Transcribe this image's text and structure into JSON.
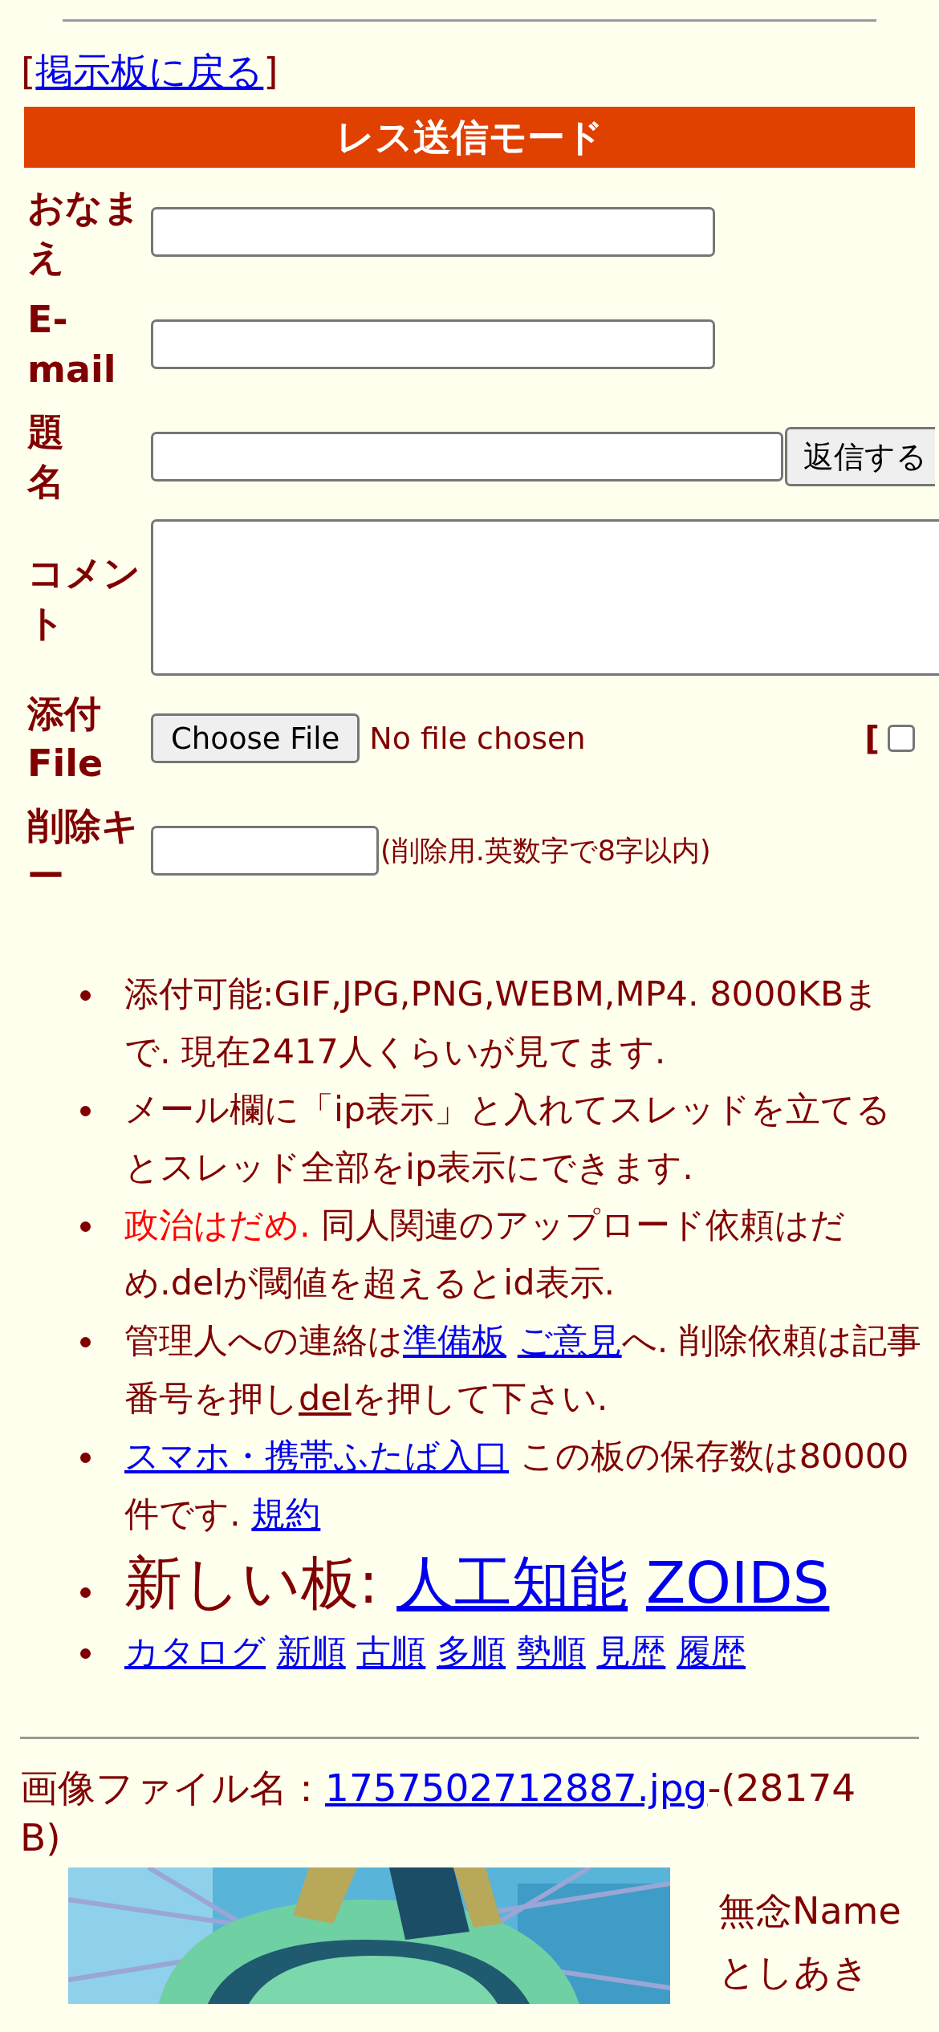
{
  "back_link": {
    "before": "[",
    "label": "掲示板に戻る",
    "after": "]"
  },
  "form_header": "レス送信モード",
  "form_rows": [
    {
      "kind": "text",
      "label": "おなまえ"
    },
    {
      "kind": "text",
      "label": "E-mail"
    },
    {
      "kind": "text_submit",
      "label": "題名",
      "button": "返信する"
    },
    {
      "kind": "textarea",
      "label": "コメント"
    },
    {
      "kind": "file",
      "label": "添付File",
      "button": "Choose File",
      "status": "No file chosen",
      "option_bracket": "[",
      "option_checked": false
    },
    {
      "kind": "password",
      "label": "削除キー",
      "hint": "(削除用.英数字で8字以内)"
    }
  ],
  "notices": [
    {
      "kind": "normal",
      "parts": [
        {
          "kind": "text",
          "text": "添付可能:GIF,JPG,PNG,WEBM,MP4. 8000KBまで. 現在2417人くらいが見てます."
        }
      ]
    },
    {
      "kind": "normal",
      "parts": [
        {
          "kind": "text",
          "text": "メール欄に「ip表示」と入れてスレッドを立てるとスレッド全部をip表示にできます."
        }
      ]
    },
    {
      "kind": "normal",
      "parts": [
        {
          "kind": "alert",
          "text": "政治はだめ."
        },
        {
          "kind": "text",
          "text": " 同人関連のアップロード依頼はだめ.delが閾値を超えるとid表示."
        }
      ]
    },
    {
      "kind": "normal",
      "parts": [
        {
          "kind": "text",
          "text": "管理人への連絡は"
        },
        {
          "kind": "link",
          "text": "準備板"
        },
        {
          "kind": "space"
        },
        {
          "kind": "link",
          "text": "ご意見"
        },
        {
          "kind": "text",
          "text": "へ. 削除依頼は記事番号を押し"
        },
        {
          "kind": "underline",
          "text": "del"
        },
        {
          "kind": "text",
          "text": "を押して下さい."
        }
      ]
    },
    {
      "kind": "normal",
      "parts": [
        {
          "kind": "link",
          "text": "スマホ・携帯ふたば入口"
        },
        {
          "kind": "text",
          "text": " この板の保存数は80000件です. "
        },
        {
          "kind": "link",
          "text": "規約"
        }
      ]
    },
    {
      "kind": "large",
      "parts": [
        {
          "kind": "text",
          "text": "新しい板: "
        },
        {
          "kind": "link",
          "text": "人工知能"
        },
        {
          "kind": "space"
        },
        {
          "kind": "link",
          "text": "ZOIDS"
        }
      ]
    },
    {
      "kind": "links",
      "parts": [
        {
          "kind": "link",
          "text": "カタログ"
        },
        {
          "kind": "link",
          "text": "新順"
        },
        {
          "kind": "link",
          "text": "古順"
        },
        {
          "kind": "link",
          "text": "多順"
        },
        {
          "kind": "link",
          "text": "勢順"
        },
        {
          "kind": "link",
          "text": "見歴"
        },
        {
          "kind": "link",
          "text": "履歴"
        }
      ]
    }
  ],
  "post": {
    "file_label": "画像ファイル名：",
    "file_name": "1757502712887.jpg",
    "file_size": "-(28174 B)",
    "subject": "無念",
    "name_label": "Name",
    "name": "としあき"
  }
}
